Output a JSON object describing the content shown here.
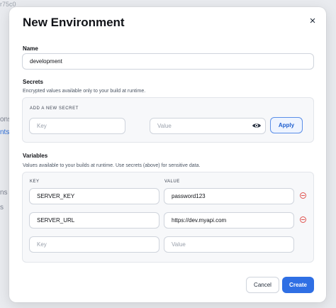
{
  "background": {
    "top_fragment": "r75c0",
    "left_fragments": [
      "ons",
      "nts",
      "ns",
      "s"
    ]
  },
  "modal": {
    "title": "New Environment",
    "close_label": "×"
  },
  "name_section": {
    "label": "Name",
    "value": "development"
  },
  "secrets": {
    "label": "Secrets",
    "description": "Encrypted values available only to your build at runtime.",
    "add_heading": "ADD A NEW SECRET",
    "key_placeholder": "Key",
    "value_placeholder": "Value",
    "apply_label": "Apply"
  },
  "variables": {
    "label": "Variables",
    "description": "Values available to your builds at runtime. Use secrets (above) for sensitive data.",
    "key_header": "KEY",
    "value_header": "VALUE",
    "rows": [
      {
        "key": "SERVER_KEY",
        "value": "password123"
      },
      {
        "key": "SERVER_URL",
        "value": "https://dev.myapi.com"
      }
    ],
    "new_key_placeholder": "Key",
    "new_value_placeholder": "Value"
  },
  "footer": {
    "cancel_label": "Cancel",
    "create_label": "Create"
  },
  "colors": {
    "primary": "#2f6fe4",
    "danger": "#e0534f"
  }
}
